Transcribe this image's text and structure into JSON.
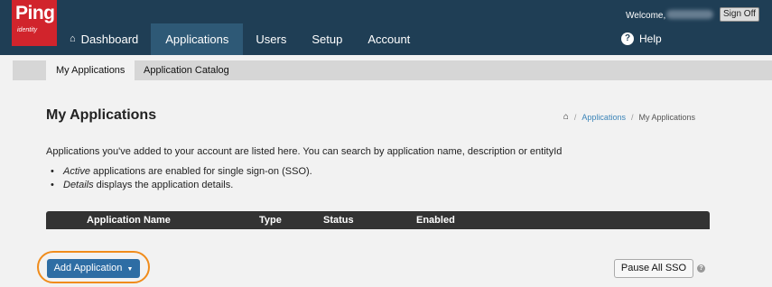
{
  "brand": {
    "logo_text": "Ping",
    "logo_sub": "identity",
    "color": "#d1242c"
  },
  "topbar": {
    "welcome": "Welcome,",
    "signoff_label": "Sign Off",
    "help_label": "Help"
  },
  "nav": {
    "items": [
      {
        "label": "Dashboard",
        "icon": "home-icon"
      },
      {
        "label": "Applications",
        "active": true
      },
      {
        "label": "Users"
      },
      {
        "label": "Setup"
      },
      {
        "label": "Account"
      }
    ]
  },
  "subnav": {
    "tabs": [
      {
        "label": "My Applications",
        "active": true
      },
      {
        "label": "Application Catalog"
      }
    ]
  },
  "page": {
    "title": "My Applications",
    "breadcrumb": {
      "link": "Applications",
      "current": "My Applications"
    },
    "intro": "Applications you've added to your account are listed here. You can search by application name, description or entityId",
    "bullets": [
      {
        "term": "Active",
        "text": "applications are enabled for single sign-on (SSO)."
      },
      {
        "term": "Details",
        "text": "displays the application details."
      }
    ]
  },
  "table": {
    "columns": [
      "Application Name",
      "Type",
      "Status",
      "Enabled"
    ]
  },
  "actions": {
    "add_label": "Add Application",
    "pause_label": "Pause All SSO"
  },
  "colors": {
    "topbar": "#1f3e55",
    "nav_active": "#2e5976",
    "primary_button": "#2e6da4",
    "highlight_ring": "#f08c1b"
  }
}
